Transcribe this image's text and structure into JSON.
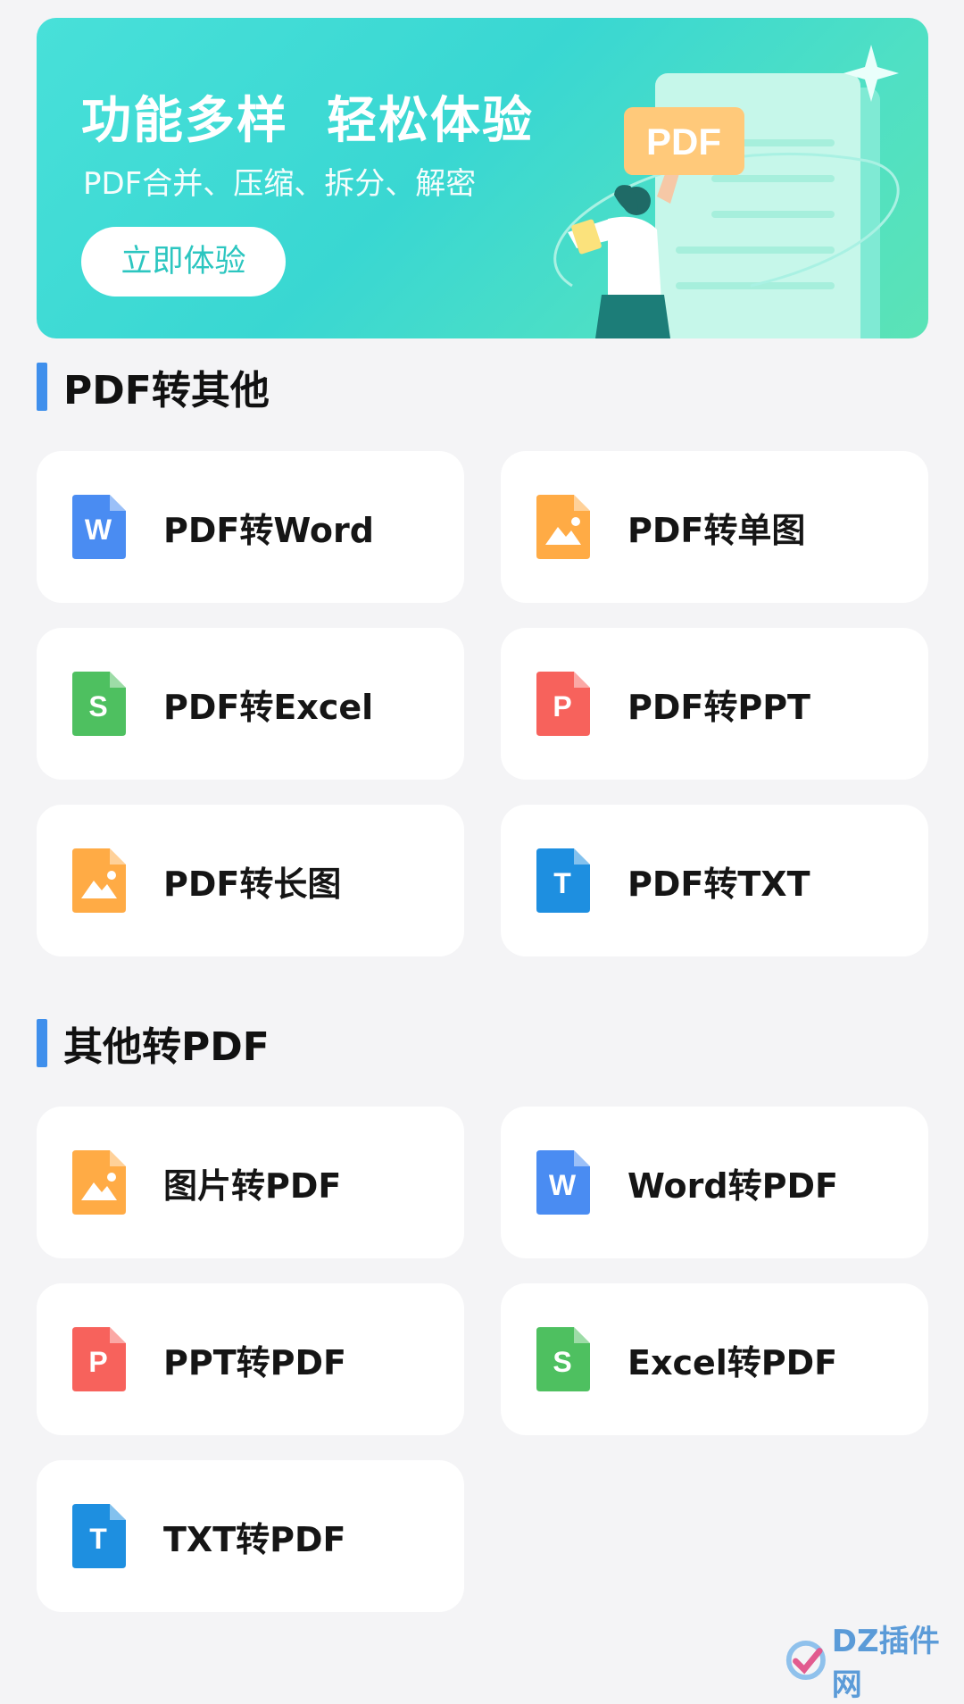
{
  "banner": {
    "title": "功能多样  轻松体验",
    "subtitle": "PDF合并、压缩、拆分、解密",
    "button_label": "立即体验",
    "badge": "PDF"
  },
  "sections": [
    {
      "title": "PDF转其他",
      "items": [
        {
          "label": "PDF转Word",
          "icon": "word-file-icon",
          "letter": "W",
          "color": "#4a8cf2"
        },
        {
          "label": "PDF转单图",
          "icon": "image-file-icon",
          "letter": "",
          "color": "#ffab45"
        },
        {
          "label": "PDF转Excel",
          "icon": "excel-file-icon",
          "letter": "S",
          "color": "#4ec060"
        },
        {
          "label": "PDF转PPT",
          "icon": "ppt-file-icon",
          "letter": "P",
          "color": "#f7625c"
        },
        {
          "label": "PDF转长图",
          "icon": "image-file-icon",
          "letter": "",
          "color": "#ffab45"
        },
        {
          "label": "PDF转TXT",
          "icon": "txt-file-icon",
          "letter": "T",
          "color": "#1e8fe0"
        }
      ]
    },
    {
      "title": "其他转PDF",
      "items": [
        {
          "label": "图片转PDF",
          "icon": "image-file-icon",
          "letter": "",
          "color": "#ffab45"
        },
        {
          "label": "Word转PDF",
          "icon": "word-file-icon",
          "letter": "W",
          "color": "#4a8cf2"
        },
        {
          "label": "PPT转PDF",
          "icon": "ppt-file-icon",
          "letter": "P",
          "color": "#f7625c"
        },
        {
          "label": "Excel转PDF",
          "icon": "excel-file-icon",
          "letter": "S",
          "color": "#4ec060"
        },
        {
          "label": "TXT转PDF",
          "icon": "txt-file-icon",
          "letter": "T",
          "color": "#1e8fe0"
        }
      ]
    }
  ],
  "colors": {
    "accent_bar": "#3f8fec",
    "banner_button_text": "#2cc6c0"
  },
  "watermark": {
    "text": "DZ插件网"
  }
}
